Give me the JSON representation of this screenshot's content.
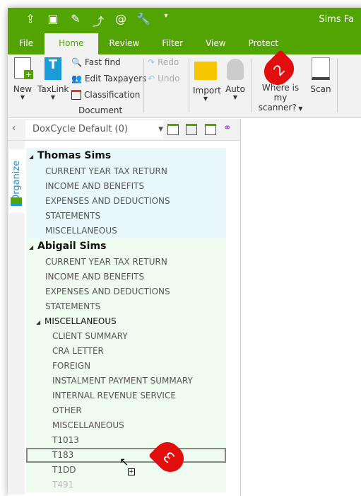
{
  "window": {
    "title": "Sims Fa"
  },
  "quick_access": [
    "share-icon",
    "save-icon",
    "edit-icon",
    "upload-icon",
    "at-icon",
    "wrench-icon",
    "dropdown-icon"
  ],
  "tabs": [
    {
      "label": "File"
    },
    {
      "label": "Home",
      "active": true
    },
    {
      "label": "Review"
    },
    {
      "label": "Filter"
    },
    {
      "label": "View"
    },
    {
      "label": "Protect"
    }
  ],
  "ribbon": {
    "new": "New",
    "taxlink": "TaxLink",
    "fast_find": "Fast find",
    "edit_taxpayers": "Edit Taxpayers",
    "classification": "Classification",
    "document_group": "Document",
    "redo": "Redo",
    "undo": "Undo",
    "import": "Import",
    "auto": "Auto",
    "where_scanner_1": "Where is my",
    "where_scanner_2": "scanner?",
    "scan": "Scan"
  },
  "panel": {
    "combo_value": "DoxCycle Default (0)",
    "side_tab": "Organize"
  },
  "tree": {
    "thomas": {
      "name": "Thomas Sims",
      "items": [
        "CURRENT YEAR TAX RETURN",
        "INCOME AND BENEFITS",
        "EXPENSES AND DEDUCTIONS",
        "STATEMENTS",
        "MISCELLANEOUS"
      ]
    },
    "abigail": {
      "name": "Abigail Sims",
      "items": [
        "CURRENT YEAR TAX RETURN",
        "INCOME AND BENEFITS",
        "EXPENSES AND DEDUCTIONS",
        "STATEMENTS"
      ],
      "misc": {
        "name": "MISCELLANEOUS",
        "children": [
          "CLIENT SUMMARY",
          "CRA LETTER",
          "FOREIGN",
          "INSTALMENT PAYMENT SUMMARY",
          "INTERNAL REVENUE SERVICE",
          "OTHER",
          "MISCELLANEOUS",
          "T1013",
          "T183",
          "T1DD",
          "T491"
        ],
        "selected": "T183"
      }
    }
  },
  "callouts": {
    "step2": "2",
    "step3": "3"
  },
  "colors": {
    "brand": "#52a401",
    "callout": "#e20e0e"
  }
}
